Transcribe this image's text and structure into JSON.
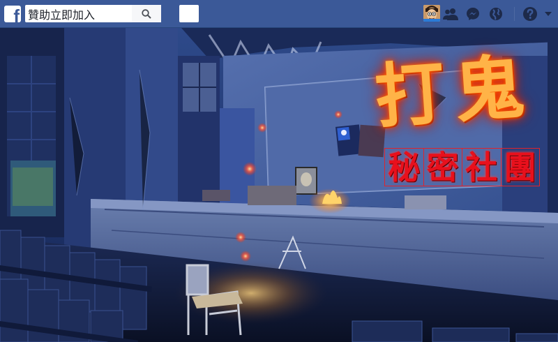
{
  "topbar": {
    "logo_letter": "f",
    "search": {
      "value": "贊助立即加入",
      "placeholder": ""
    },
    "icons": [
      "facebook-logo-icon",
      "search-icon",
      "friends-icon",
      "messenger-icon",
      "globe-icon",
      "help-icon",
      "chevron-down-icon"
    ]
  },
  "cover": {
    "title": "打鬼",
    "subtitle_chars": [
      "秘",
      "密",
      "社",
      "團"
    ]
  },
  "colors": {
    "fb_blue": "#3b5998",
    "title_orange": "#ffb347",
    "subtitle_red": "#e8101c"
  }
}
